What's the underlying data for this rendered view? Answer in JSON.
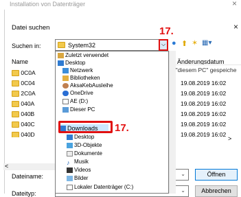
{
  "outer_window": {
    "title": "Installation von Datenträger",
    "close": "×"
  },
  "dialog": {
    "title": "Datei suchen",
    "close": "×"
  },
  "lookin": {
    "label": "Suchen in:",
    "value": "System32"
  },
  "annotation": {
    "step": "17."
  },
  "columns": {
    "name": "Name",
    "date": "Änderungsdatum"
  },
  "files": [
    {
      "name": "0C0A",
      "date": ""
    },
    {
      "name": "0C04",
      "date": "19.08.2019 16:02"
    },
    {
      "name": "2C0A",
      "date": "19.08.2019 16:02"
    },
    {
      "name": "040A",
      "date": "19.08.2019 16:02"
    },
    {
      "name": "040B",
      "date": "19.08.2019 16:02"
    },
    {
      "name": "040C",
      "date": "19.08.2019 16:02"
    },
    {
      "name": "040D",
      "date": "19.08.2019 16:02"
    }
  ],
  "extra_text": "f \"diesem PC\" gespeiche",
  "dropdown_items": [
    {
      "label": "Zuletzt verwendet",
      "icon": "recent-icon"
    },
    {
      "label": "Desktop",
      "icon": "desktop-icon"
    },
    {
      "label": "Netzwerk",
      "icon": "network-icon"
    },
    {
      "label": "Bibliotheken",
      "icon": "library-icon"
    },
    {
      "label": "AksaKebAusleihe",
      "icon": "user-icon"
    },
    {
      "label": "OneDrive",
      "icon": "cloud-icon"
    },
    {
      "label": "AE (D:)",
      "icon": "drive-icon"
    },
    {
      "label": "Dieser PC",
      "icon": "pc-icon"
    },
    {
      "label": "Downloads",
      "icon": "download-icon"
    },
    {
      "label": "Desktop",
      "icon": "desktop-icon"
    },
    {
      "label": "3D-Objekte",
      "icon": "3d-icon"
    },
    {
      "label": "Dokumente",
      "icon": "documents-icon"
    },
    {
      "label": "Musik",
      "icon": "music-icon"
    },
    {
      "label": "Videos",
      "icon": "video-icon"
    },
    {
      "label": "Bilder",
      "icon": "pictures-icon"
    },
    {
      "label": "Lokaler Datenträger (C:)",
      "icon": "drive-icon"
    }
  ],
  "filename": {
    "label": "Dateiname:",
    "value": ""
  },
  "filetype": {
    "label": "Dateityp:",
    "value": ""
  },
  "buttons": {
    "open": "Öffnen",
    "cancel": "Abbrechen"
  },
  "colors": {
    "highlight": "#e01010",
    "selection": "#cde8ff",
    "folder": "#f2c94c"
  }
}
